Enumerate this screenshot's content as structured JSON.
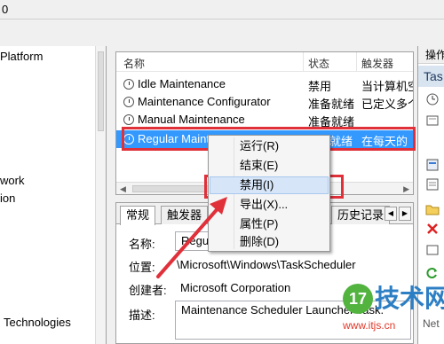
{
  "top_strip": {
    "text": "0"
  },
  "left_tree": {
    "items": [
      {
        "label": "Platform"
      },
      {
        "label": "work"
      },
      {
        "label": "ion"
      },
      {
        "label": "Technologies"
      }
    ]
  },
  "task_list": {
    "columns": {
      "name": "名称",
      "status": "状态",
      "trigger": "触发器"
    },
    "rows": [
      {
        "name": "Idle Maintenance",
        "status": "禁用",
        "trigger": "当计算机空"
      },
      {
        "name": "Maintenance Configurator",
        "status": "准备就绪",
        "trigger": "已定义多个"
      },
      {
        "name": "Manual Maintenance",
        "status": "准备就绪",
        "trigger": ""
      },
      {
        "name": "Regular Maint",
        "status": "就绪",
        "trigger": "在每天的"
      }
    ]
  },
  "context_menu": {
    "items": [
      {
        "label": "运行(R)"
      },
      {
        "label": "结束(E)"
      },
      {
        "label": "禁用(I)"
      },
      {
        "label": "导出(X)..."
      },
      {
        "label": "属性(P)"
      },
      {
        "label": "删除(D)"
      }
    ]
  },
  "details": {
    "tabs": [
      {
        "label": "常规"
      },
      {
        "label": "触发器"
      },
      {
        "label": "历史记录"
      }
    ],
    "fields": {
      "name_label": "名称:",
      "name_value": "Regul",
      "location_label": "位置:",
      "location_value": "\\Microsoft\\Windows\\TaskScheduler",
      "author_label": "创建者:",
      "author_value": "Microsoft Corporation",
      "desc_label": "描述:",
      "desc_value": "Maintenance Scheduler Launcher Task."
    }
  },
  "actions_pane": {
    "header": "操作",
    "sub": "Tas"
  },
  "watermark": {
    "brand": "技术网",
    "badge": "17",
    "url": "www.itjs.cn",
    "suffix": "Net"
  },
  "colors": {
    "selection": "#3399ff",
    "highlight_box": "#e0303a",
    "menu_hover": "#d6e5f7"
  }
}
